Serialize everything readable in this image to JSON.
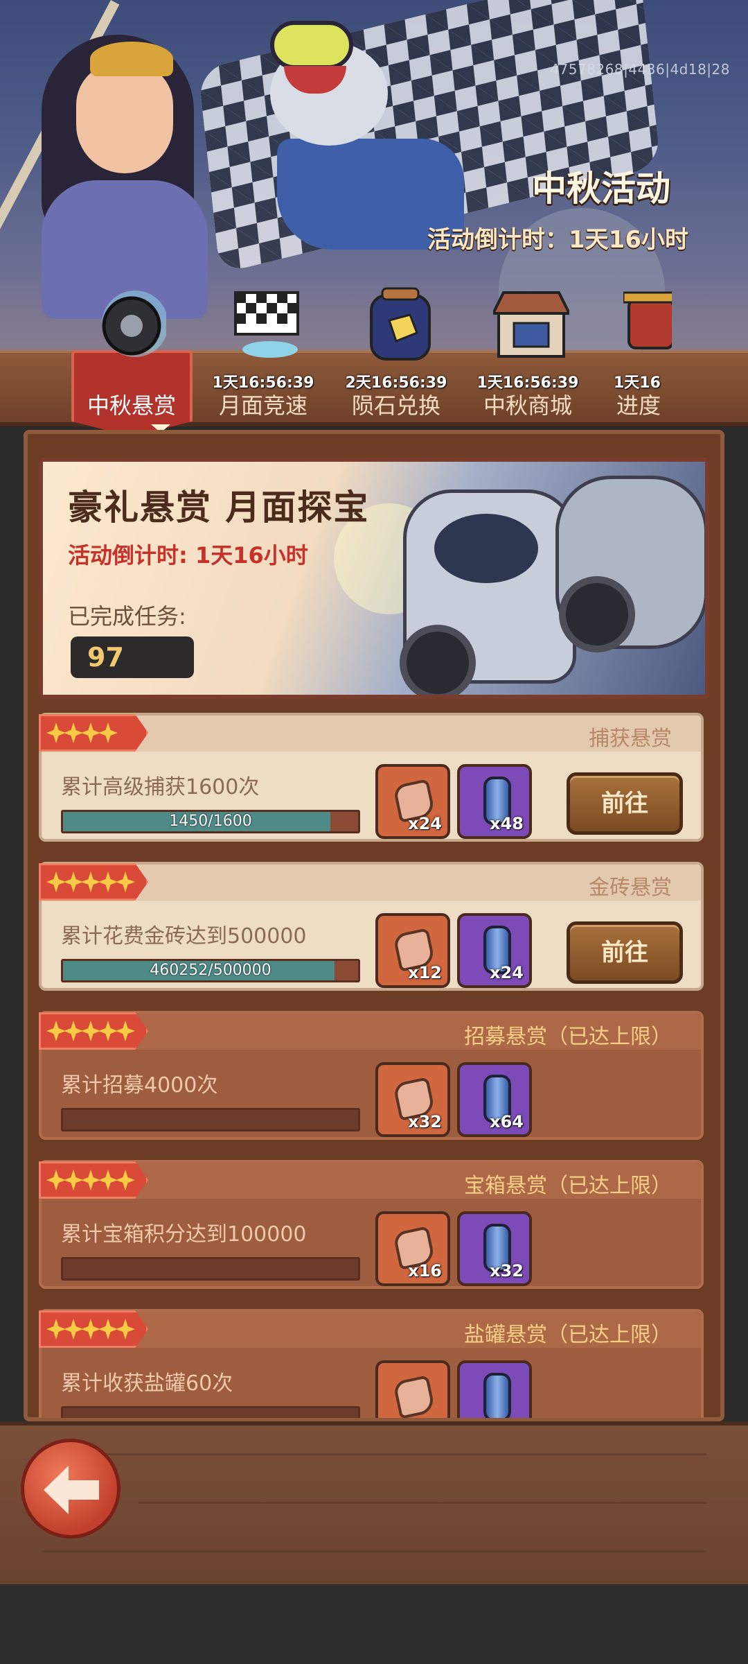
{
  "header": {
    "uid": "47578268|4436|4d18|28",
    "event_title": "中秋活动",
    "event_countdown": "活动倒计时：1天16小时"
  },
  "tabs": [
    {
      "label": "中秋悬赏",
      "timer": "",
      "active": true,
      "icon": "tire-icon"
    },
    {
      "label": "月面竞速",
      "timer": "1天16:56:39",
      "active": false,
      "icon": "checkered-flag-icon"
    },
    {
      "label": "陨石兑换",
      "timer": "2天16:56:39",
      "active": false,
      "icon": "meteor-jar-icon"
    },
    {
      "label": "中秋商城",
      "timer": "1天16:56:39",
      "active": false,
      "icon": "shop-icon"
    },
    {
      "label": "进度",
      "timer": "1天16",
      "active": false,
      "icon": "lantern-icon"
    }
  ],
  "banner": {
    "title": "豪礼悬赏 月面探宝",
    "countdown": "活动倒计时: 1天16小时",
    "done_label": "已完成任务:",
    "done_value": "97"
  },
  "tasks": [
    {
      "category": "捕获悬赏",
      "desc": "累计高级捕获1600次",
      "progress_text": "1450/1600",
      "progress": 0.906,
      "stars": 4,
      "reward1": "x24",
      "reward2": "x48",
      "button": "前往",
      "capped": false
    },
    {
      "category": "金砖悬赏",
      "desc": "累计花费金砖达到500000",
      "progress_text": "460252/500000",
      "progress": 0.92,
      "stars": 5,
      "reward1": "x12",
      "reward2": "x24",
      "button": "前往",
      "capped": false
    },
    {
      "category": "招募悬赏（已达上限）",
      "desc": "累计招募4000次",
      "progress_text": "",
      "progress": 0,
      "stars": 5,
      "reward1": "x32",
      "reward2": "x64",
      "button": "",
      "capped": true
    },
    {
      "category": "宝箱悬赏（已达上限）",
      "desc": "累计宝箱积分达到100000",
      "progress_text": "",
      "progress": 0,
      "stars": 5,
      "reward1": "x16",
      "reward2": "x32",
      "button": "",
      "capped": true
    },
    {
      "category": "盐罐悬赏（已达上限）",
      "desc": "累计收获盐罐60次",
      "progress_text": "",
      "progress": 0,
      "stars": 5,
      "reward1": "",
      "reward2": "",
      "button": "",
      "capped": true
    }
  ],
  "colors": {
    "accent_red": "#b1332c",
    "progress_fill": "#4e8a86",
    "stars": "#f7cb43"
  }
}
